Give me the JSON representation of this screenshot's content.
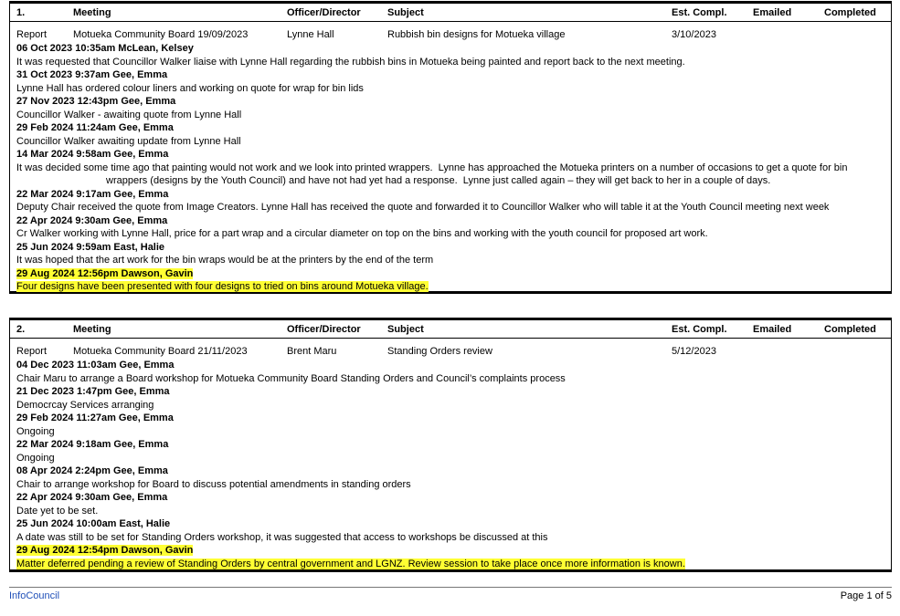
{
  "columns": {
    "meeting": "Meeting",
    "officer": "Officer/Director",
    "subject": "Subject",
    "est": "Est. Compl.",
    "emailed": "Emailed",
    "completed": "Completed"
  },
  "items": [
    {
      "number": "1.",
      "type": "Report",
      "meeting": "Motueka Community Board 19/09/2023",
      "officer": "Lynne Hall",
      "subject": "Rubbish bin designs for Motueka village",
      "est": "3/10/2023",
      "emailed": "",
      "completed": "",
      "entries": [
        {
          "head": "06 Oct 2023 10:35am McLean, Kelsey",
          "body": "It was requested that Councillor Walker liaise with Lynne Hall regarding the rubbish bins in Motueka being painted and report back to the next meeting."
        },
        {
          "head": "31 Oct 2023 9:37am Gee, Emma",
          "body": "Lynne Hall has ordered colour liners and working on quote for wrap for bin lids"
        },
        {
          "head": "27 Nov 2023 12:43pm Gee, Emma",
          "body": "Councillor Walker - awaiting quote from Lynne Hall"
        },
        {
          "head": "29 Feb 2024 11:24am Gee, Emma",
          "body": "Councillor Walker awaiting update from Lynne Hall"
        },
        {
          "head": "14 Mar 2024 9:58am Gee, Emma",
          "body": "It was decided some time ago that painting would not work and we look into printed wrappers.  Lynne has approached the Motueka printers on a number of occasions to get a quote for bin wrappers (designs by the Youth Council) and have not had yet had a response.  Lynne just called again – they will get back to her in a couple of days."
        },
        {
          "head": "22 Mar 2024 9:17am Gee, Emma",
          "body": "Deputy Chair received the quote from Image Creators. Lynne Hall has received the quote and forwarded it to Councillor Walker who will table it at the Youth Council meeting next week"
        },
        {
          "head": "22 Apr 2024 9:30am Gee, Emma",
          "body": "Cr Walker working with Lynne Hall, price for a part wrap and a circular diameter on top on the bins and working with the youth council for proposed art work."
        },
        {
          "head": "25 Jun 2024 9:59am East, Halie",
          "body": "It was hoped that the art work for the bin wraps would be at the printers by the end of the term"
        },
        {
          "head": "29 Aug 2024 12:56pm Dawson, Gavin",
          "body": "Four designs have been presented with four designs to tried on bins around Motueka village."
        }
      ]
    },
    {
      "number": "2.",
      "type": "Report",
      "meeting": "Motueka Community Board 21/11/2023",
      "officer": "Brent Maru",
      "subject": "Standing Orders review",
      "est": "5/12/2023",
      "emailed": "",
      "completed": "",
      "entries": [
        {
          "head": "04 Dec 2023 11:03am Gee, Emma",
          "body": "Chair Maru to arrange a Board workshop for Motueka Community Board Standing Orders and Council’s complaints process"
        },
        {
          "head": "21 Dec 2023 1:47pm Gee, Emma",
          "body": "Democrcay Services arranging"
        },
        {
          "head": "29 Feb 2024 11:27am Gee, Emma",
          "body": "Ongoing"
        },
        {
          "head": "22 Mar 2024 9:18am Gee, Emma",
          "body": "Ongoing"
        },
        {
          "head": "08 Apr 2024 2:24pm Gee, Emma",
          "body": "Chair to arrange workshop for Board to discuss potential amendments in standing orders"
        },
        {
          "head": "22 Apr 2024 9:30am Gee, Emma",
          "body": "Date yet to be set."
        },
        {
          "head": "25 Jun 2024 10:00am East, Halie",
          "body": "A date was still to be set for Standing Orders workshop, it was suggested that access to workshops be discussed at this"
        },
        {
          "head": "29 Aug 2024 12:54pm Dawson, Gavin",
          "body": "Matter deferred pending a review of Standing Orders by central government and LGNZ. Review session to take place once more information is known."
        }
      ]
    }
  ],
  "highlight_color": "#ffff33",
  "footer": {
    "brand": "InfoCouncil",
    "page": "Page 1 of 5"
  }
}
